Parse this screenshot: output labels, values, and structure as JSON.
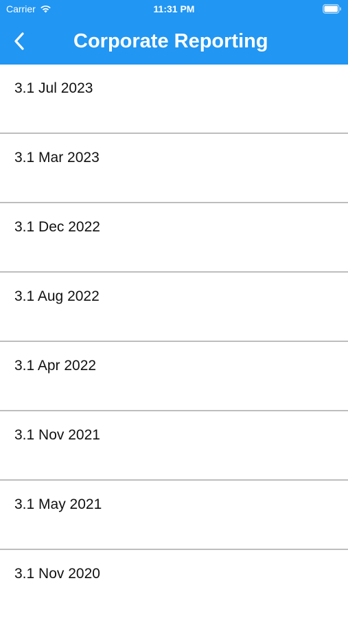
{
  "status_bar": {
    "carrier": "Carrier",
    "time": "11:31 PM"
  },
  "nav": {
    "title": "Corporate Reporting",
    "back_icon": "chevron-left-icon"
  },
  "colors": {
    "app_bar": "#2196f3",
    "divider": "#bdbdbd",
    "text": "#111111"
  },
  "reports": [
    {
      "label": "3.1 Jul 2023"
    },
    {
      "label": "3.1 Mar 2023"
    },
    {
      "label": "3.1 Dec 2022"
    },
    {
      "label": "3.1 Aug 2022"
    },
    {
      "label": "3.1 Apr 2022"
    },
    {
      "label": "3.1 Nov 2021"
    },
    {
      "label": "3.1 May 2021"
    },
    {
      "label": "3.1 Nov 2020"
    }
  ]
}
